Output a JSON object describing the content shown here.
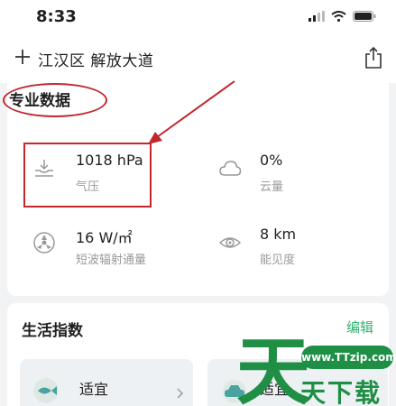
{
  "status_bar": {
    "time": "8:33"
  },
  "header": {
    "location": "江汉区 解放大道"
  },
  "professional": {
    "title": "专业数据",
    "items": [
      {
        "value": "1018 hPa",
        "label": "气压",
        "icon": "pressure-icon"
      },
      {
        "value": "0%",
        "label": "云量",
        "icon": "cloud-icon"
      },
      {
        "value": "16 W/㎡",
        "label": "短波辐射通量",
        "icon": "radiation-icon"
      },
      {
        "value": "8 km",
        "label": "能见度",
        "icon": "eye-icon"
      }
    ]
  },
  "life": {
    "title": "生活指数",
    "edit_label": "编辑",
    "tiles": [
      {
        "value": "适宜",
        "icon": "fish-icon"
      },
      {
        "value": "适宜",
        "icon": "car-icon"
      }
    ]
  },
  "watermark": {
    "big_char": "天",
    "url": "www.TTzip.com",
    "text": "天下载"
  },
  "colors": {
    "accent": "#2fb36e",
    "annotation": "#c1272d",
    "watermark": "#1f8f45"
  }
}
